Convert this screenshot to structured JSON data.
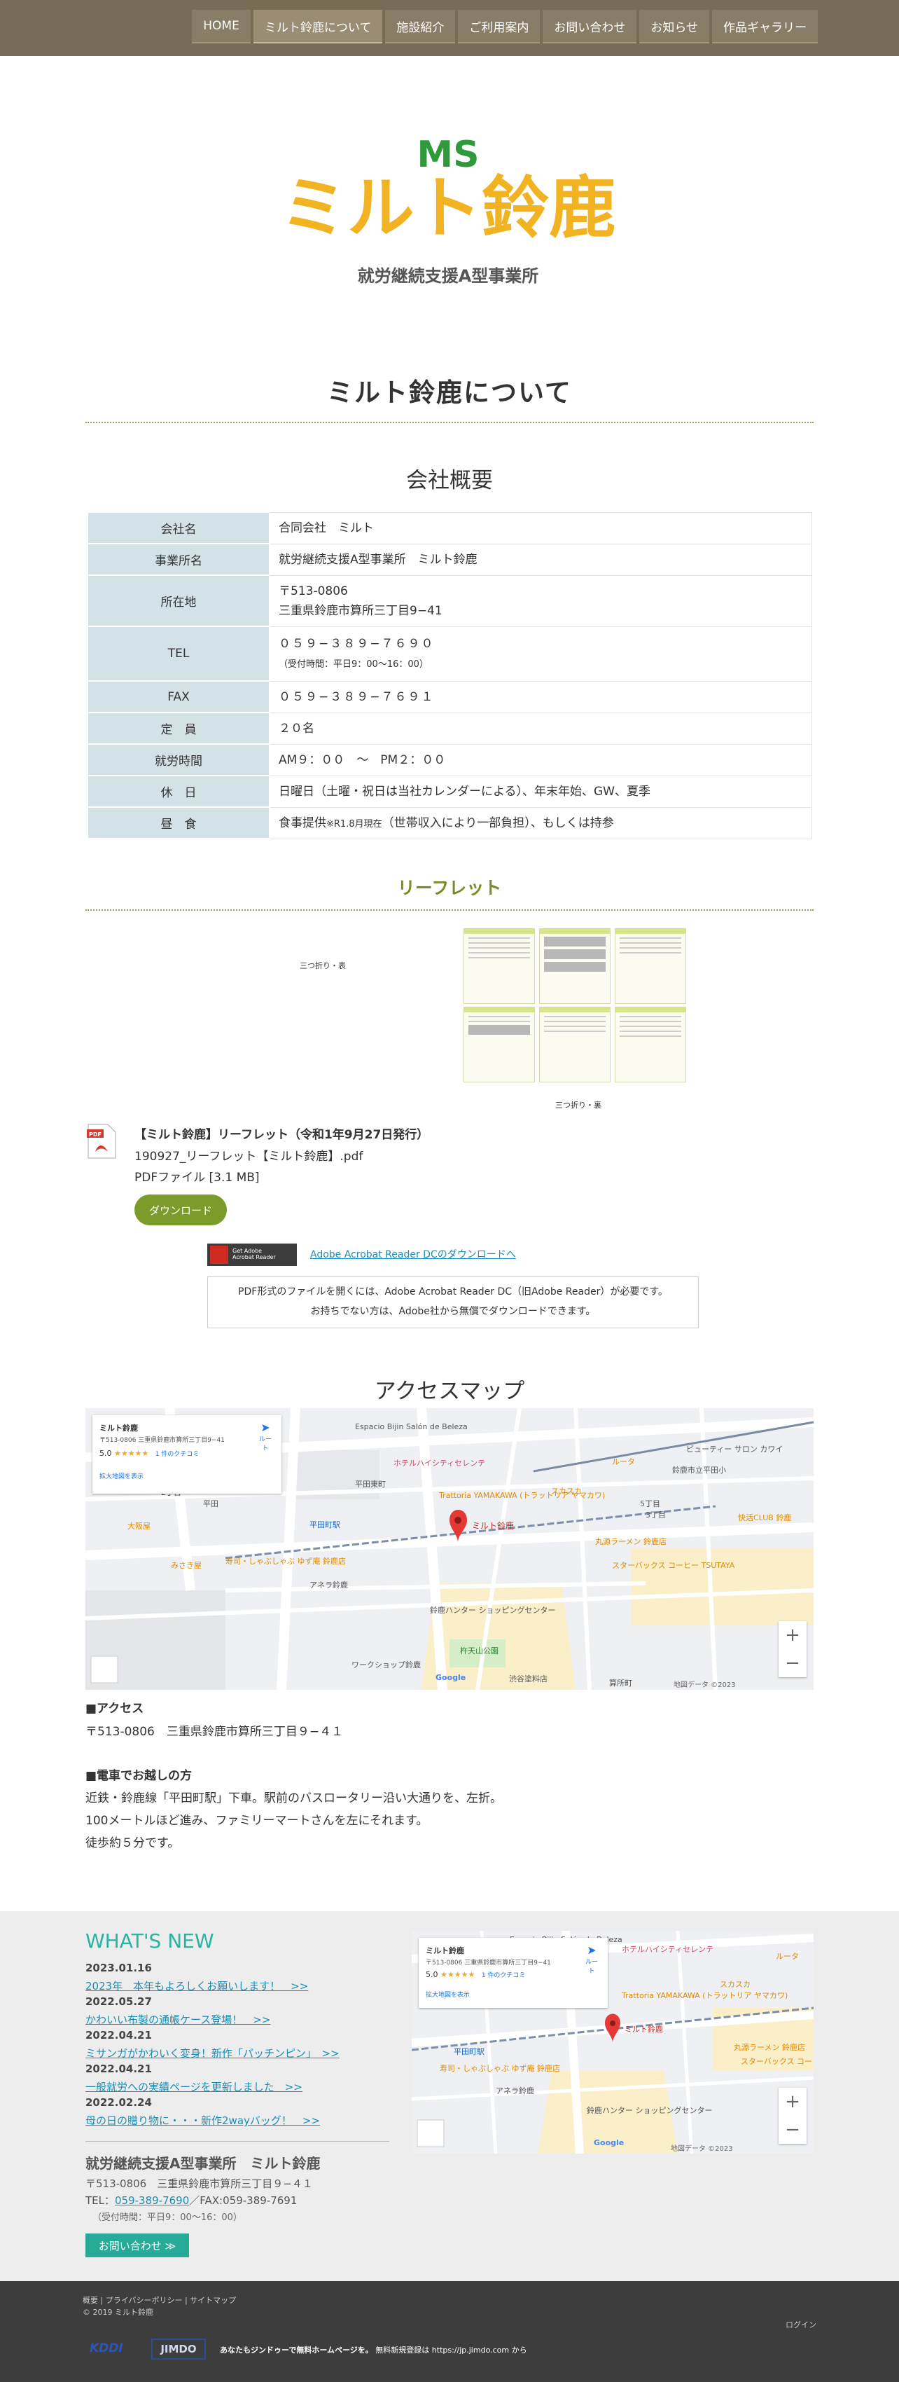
{
  "nav": {
    "items": [
      "HOME",
      "ミルト鈴鹿について",
      "施設紹介",
      "ご利用案内",
      "お問い合わせ",
      "お知らせ",
      "作品ギャラリー"
    ]
  },
  "logo": {
    "mark": "MS",
    "name": "ミルト鈴鹿",
    "subtitle": "就労継続支援A型事業所"
  },
  "page_title": "ミルト鈴鹿について",
  "company": {
    "heading": "会社概要",
    "rows": [
      {
        "label": "会社名",
        "value": "合同会社　ミルト"
      },
      {
        "label": "事業所名",
        "value": "就労継続支援A型事業所　ミルト鈴鹿"
      },
      {
        "label": "所在地",
        "value": "〒513-0806",
        "value2": "三重県鈴鹿市算所三丁目9−41"
      },
      {
        "label": "TEL",
        "value": "０５９−３８９−７６９０",
        "value2": "（受付時間：平日9：00〜16：00）"
      },
      {
        "label": "FAX",
        "value": "０５９−３８９−７６９１"
      },
      {
        "label": "定　員",
        "value": "２０名"
      },
      {
        "label": "就労時間",
        "value": "AM９：００　〜　PM２：００"
      },
      {
        "label": "休　日",
        "value": "日曜日（土曜・祝日は当社カレンダーによる）、年末年始、GW、夏季"
      },
      {
        "label": "昼　食",
        "value": "食事提供",
        "value_small": "※R1.8月現在",
        "value3": "（世帯収入により一部負担）、もしくは持参"
      }
    ]
  },
  "leaflet": {
    "heading": "リーフレット",
    "caption_front": "三つ折り・表",
    "caption_back": "三つ折り・裏",
    "file_title": "【ミルト鈴鹿】リーフレット（令和1年9月27日発行）",
    "file_name": "190927_リーフレット【ミルト鈴鹿】.pdf",
    "file_size": "PDFファイル [3.1 MB]",
    "download": "ダウンロード",
    "pdf_icon_label": "PDF",
    "acrobat_badge_line1": "Get Adobe",
    "acrobat_badge_line2": "Acrobat Reader",
    "acrobat_link": "Adobe Acrobat Reader DCのダウンロードへ",
    "acrobat_note1": "PDF形式のファイルを開くには、Adobe Acrobat Reader DC（旧Adobe Reader）が必要です。",
    "acrobat_note2": "お持ちでない方は、Adobe社から無償でダウンロードできます。"
  },
  "access": {
    "heading": "アクセスマップ",
    "map": {
      "card_title": "ミルト鈴鹿",
      "card_addr": "〒513-0806 三重県鈴鹿市算所三丁目9−41",
      "rating": "5.0",
      "stars": "★★★★★",
      "reviews": "1 件のクチコミ",
      "card_link": "拡大地図を表示",
      "route": "ルート",
      "pin_label": "ミルト鈴鹿",
      "zoom_in": "+",
      "zoom_out": "−",
      "attribution": "地図データ ©2023",
      "place_labels": [
        "Espacio Bijin Salón de Beleza",
        "ホテルハイシティセレンテ",
        "平田東町",
        "スカスカ",
        "ルータ",
        "ビューティー サロン カワイ",
        "鈴鹿市立平田小",
        "快活CLUB 鈴鹿",
        "Trattoria YAMAKAWA (トラットリア ヤマカワ)",
        "丸源ラーメン 鈴鹿店",
        "スターバックス コーヒー TSUTAYA",
        "平田町駅",
        "大阪屋",
        "みさき屋",
        "寿司・しゃぶしゃぶ ゆず庵 鈴鹿店",
        "アネラ鈴鹿",
        "鈴鹿ハンター ショッピングセンター",
        "ワークショップ鈴鹿",
        "杵天山公園",
        "渋谷塗料店",
        "算所町",
        "平田",
        "2丁目",
        "3丁目",
        "5丁目",
        "Google"
      ]
    },
    "access_h": "■アクセス",
    "address": "〒513-0806　三重県鈴鹿市算所三丁目９−４１",
    "train_h": "■電車でお越しの方",
    "train_lines": [
      "近鉄・鈴鹿線「平田町駅」下車。駅前のバスロータリー沿い大通りを、左折。",
      "100メートルほど進み、ファミリーマートさんを左にそれます。",
      "徒歩約５分です。"
    ]
  },
  "whats_new": {
    "title": "WHAT'S NEW",
    "items": [
      {
        "date": "2023.01.16",
        "text": "2023年　本年もよろしくお願いします！　>>"
      },
      {
        "date": "2022.05.27",
        "text": "かわいい布製の通帳ケース登場！　>>"
      },
      {
        "date": "2022.04.21",
        "text": "ミサンガがかわいく変身！新作「パッチンピン」　>>"
      },
      {
        "date": "2022.04.21",
        "text": "一般就労への実績ページを更新しました　>>"
      },
      {
        "date": "2022.02.24",
        "text": "母の日の贈り物に・・・新作2wayバッグ！　>>"
      }
    ]
  },
  "footer": {
    "name": "就労継続支援A型事業所　ミルト鈴鹿",
    "address": "〒513-0806　三重県鈴鹿市算所三丁目９−４１",
    "tel_label": "TEL：",
    "tel": "059-389-7690",
    "fax": "／FAX:059-389-7691",
    "hours": "（受付時間：平日9：00〜16：00）",
    "contact": "お問い合わせ ≫",
    "links": "概要 | プライバシーポリシー | サイトマップ",
    "copyright": "© 2019 ミルト鈴鹿",
    "login": "ログイン",
    "logo1": "KDDI",
    "logo2": "JIMDO",
    "promo_bold": "あなたもジンドゥーで無料ホームページを。",
    "promo_rest": " 無料新規登録は https://jp.jimdo.com から"
  },
  "colors": {
    "nav_bg": "#786c57",
    "table_label_bg": "#d3e2e6",
    "accent_green": "#7b9b2a",
    "teal": "#27aa98",
    "link": "#1a8eb6",
    "logo_yellow": "#f2b322",
    "logo_green": "#2e9a3c"
  }
}
